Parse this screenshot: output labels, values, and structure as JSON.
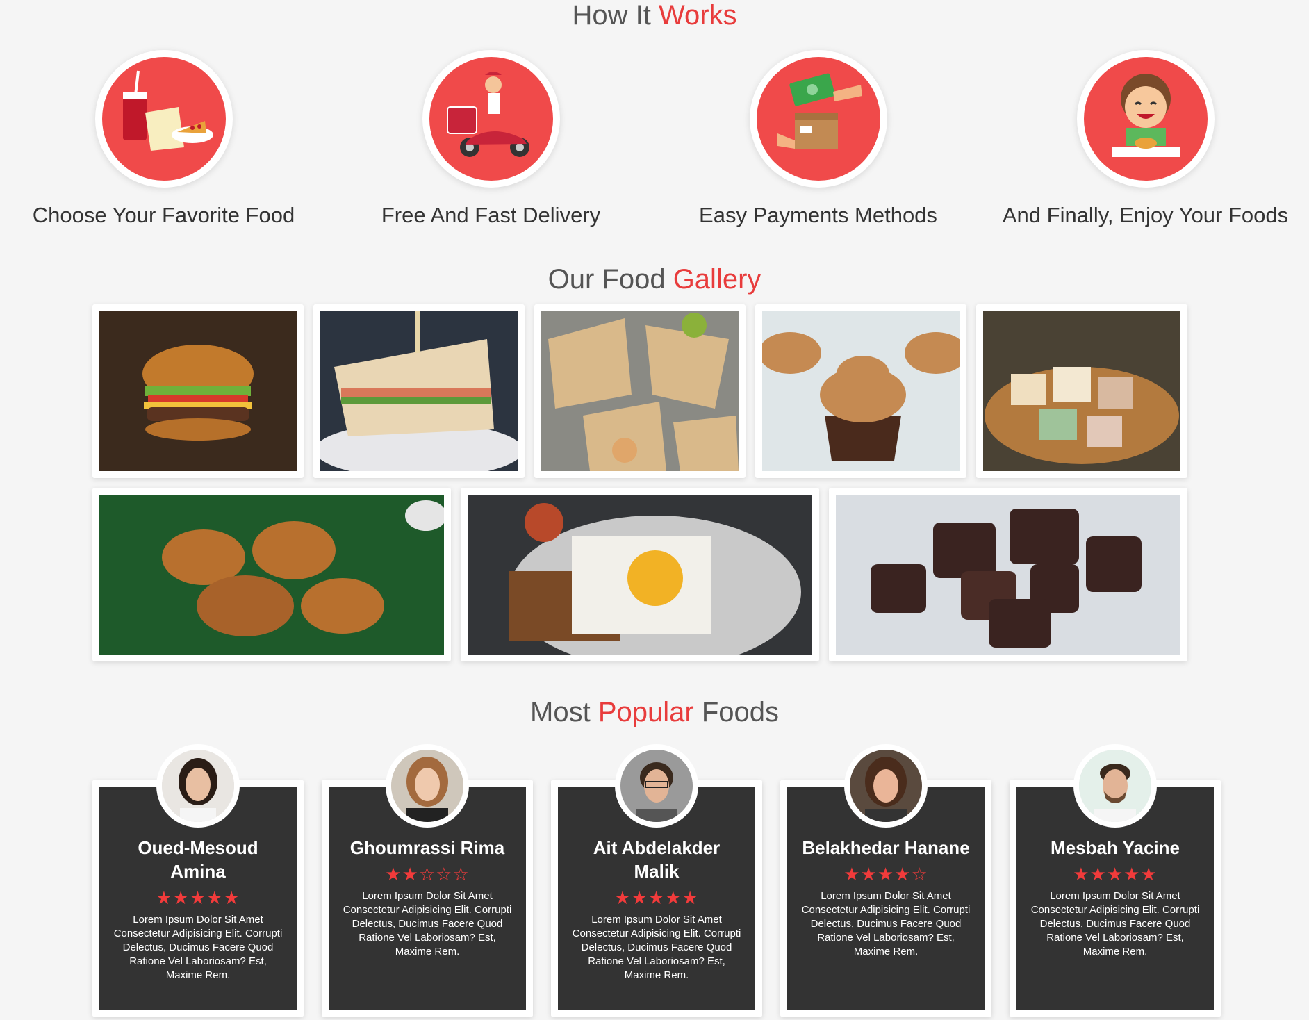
{
  "how_it_works": {
    "title_main": "How It",
    "title_accent": "Works",
    "steps": [
      {
        "label": "Choose Your Favorite Food",
        "icon": "meal-icon"
      },
      {
        "label": "Free And Fast Delivery",
        "icon": "delivery-scooter-icon"
      },
      {
        "label": "Easy Payments Methods",
        "icon": "payment-icon"
      },
      {
        "label": "And Finally, Enjoy Your Foods",
        "icon": "happy-eater-icon"
      }
    ]
  },
  "gallery": {
    "title_main": "Our Food",
    "title_accent": "Gallery",
    "row1": [
      "burger",
      "sandwich",
      "wraps",
      "cupcakes",
      "sweets"
    ],
    "row2": [
      "fried-chicken",
      "egg-toast",
      "chocolates"
    ]
  },
  "popular": {
    "title_main": "Most",
    "title_accent": "Popular",
    "title_end": "Foods",
    "reviews": [
      {
        "name": "Oued-Mesoud Amina",
        "stars": "★★★★★",
        "text": "Lorem Ipsum Dolor Sit Amet Consectetur Adipisicing Elit. Corrupti Delectus, Ducimus Facere Quod Ratione Vel Laboriosam? Est, Maxime Rem."
      },
      {
        "name": "Ghoumrassi Rima",
        "stars": "★★☆☆☆",
        "text": "Lorem Ipsum Dolor Sit Amet Consectetur Adipisicing Elit. Corrupti Delectus, Ducimus Facere Quod Ratione Vel Laboriosam? Est, Maxime Rem."
      },
      {
        "name": "Ait Abdelakder Malik",
        "stars": "★★★★★",
        "text": "Lorem Ipsum Dolor Sit Amet Consectetur Adipisicing Elit. Corrupti Delectus, Ducimus Facere Quod Ratione Vel Laboriosam? Est, Maxime Rem."
      },
      {
        "name": "Belakhedar Hanane",
        "stars": "★★★★☆",
        "text": "Lorem Ipsum Dolor Sit Amet Consectetur Adipisicing Elit. Corrupti Delectus, Ducimus Facere Quod Ratione Vel Laboriosam? Est, Maxime Rem."
      },
      {
        "name": "Mesbah Yacine",
        "stars": "★★★★★",
        "text": "Lorem Ipsum Dolor Sit Amet Consectetur Adipisicing Elit. Corrupti Delectus, Ducimus Facere Quod Ratione Vel Laboriosam? Est, Maxime Rem."
      }
    ]
  },
  "colors": {
    "accent": "#e83c3c",
    "card_bg": "#333333",
    "page_bg": "#f5f5f5"
  }
}
